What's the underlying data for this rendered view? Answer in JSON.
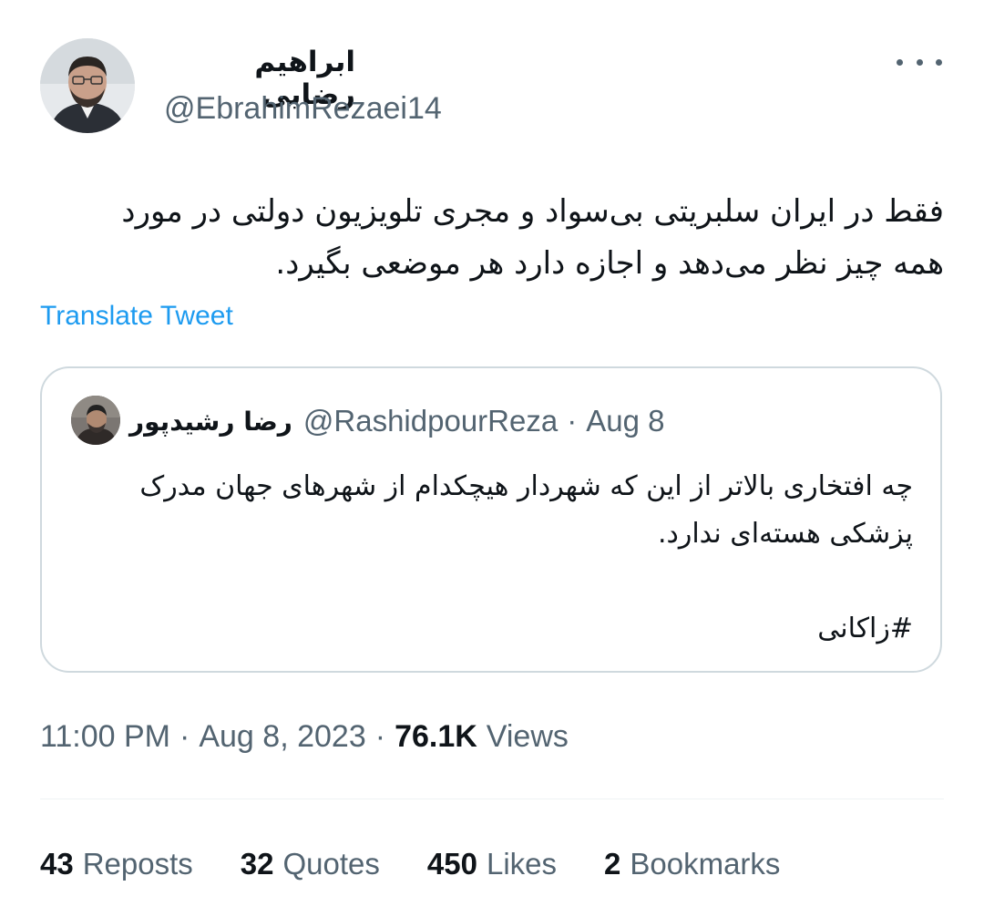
{
  "tweet": {
    "author": {
      "name": "ابراهیم رضایی",
      "handle": "@EbrahimRezaei14"
    },
    "more_icon": "more-dots-icon",
    "text": "فقط در ایران سلبریتی بی‌سواد و مجری تلویزیون دولتی در مورد\nهمه چیز نظر می‌دهد و اجازه دارد هر موضعی بگیرد.",
    "translate_label": "Translate Tweet",
    "quoted": {
      "name": "رضا رشیدپور",
      "handle": "@RashidpourReza",
      "separator": "·",
      "date": "Aug 8",
      "text": "چه افتخاری بالاتر از این که شهردار هیچکدام از شهرهای جهان مدرک\nپزشکی هسته‌ای ندارد.\n\n#زاکانی"
    },
    "meta": {
      "time": "11:00 PM",
      "separator": "·",
      "date": "Aug 8, 2023",
      "views_count": "76.1K",
      "views_label": "Views"
    },
    "stats": [
      {
        "count": "43",
        "label": "Reposts"
      },
      {
        "count": "32",
        "label": "Quotes"
      },
      {
        "count": "450",
        "label": "Likes"
      },
      {
        "count": "2",
        "label": "Bookmarks"
      }
    ]
  },
  "colors": {
    "text_primary": "#0f1419",
    "text_secondary": "#536471",
    "link": "#1d9bf0",
    "border": "#cfd9de",
    "divider": "#eff3f4"
  }
}
